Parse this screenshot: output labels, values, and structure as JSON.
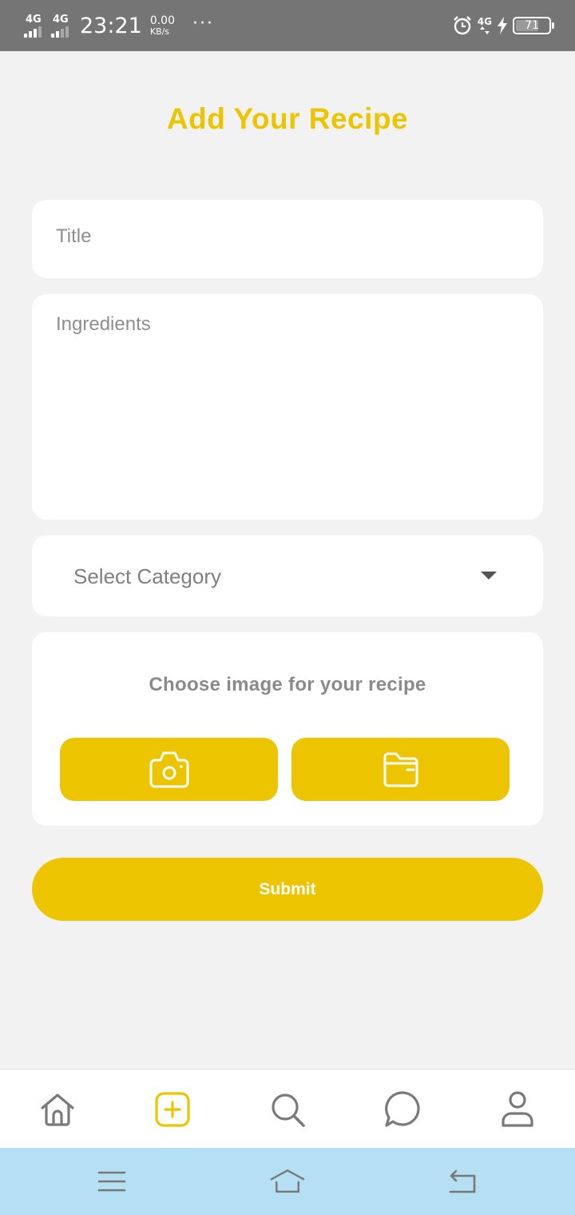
{
  "status_bar": {
    "signal1_label": "4G",
    "signal2_label": "4G",
    "time": "23:21",
    "speed_value": "0.00",
    "speed_unit": "KB/s",
    "more": "···",
    "network_right": "4G",
    "battery_level": "71",
    "battery_fraction": 0.71
  },
  "page": {
    "title": "Add Your Recipe"
  },
  "form": {
    "title_placeholder": "Title",
    "ingredients_placeholder": "Ingredients",
    "category_selected": "Select Category",
    "image_prompt": "Choose image for your recipe",
    "camera_icon": "camera-icon",
    "gallery_icon": "folder-icon",
    "submit_label": "Submit"
  },
  "bottom_nav": {
    "items": [
      {
        "icon": "home-icon",
        "active": false
      },
      {
        "icon": "add-icon",
        "active": true
      },
      {
        "icon": "search-icon",
        "active": false
      },
      {
        "icon": "chat-icon",
        "active": false
      },
      {
        "icon": "profile-icon",
        "active": false
      }
    ]
  },
  "colors": {
    "accent": "#ecc400",
    "background": "#f2f2f2",
    "placeholder": "#8e8e8e",
    "status_bar": "#757575",
    "system_nav": "#b5dff3"
  }
}
